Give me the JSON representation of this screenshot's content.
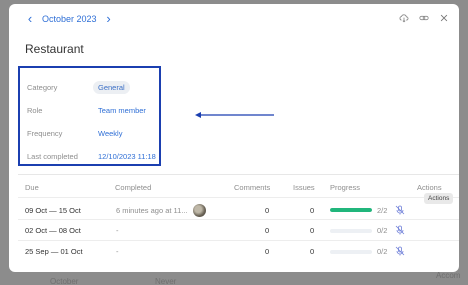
{
  "header": {
    "month_label": "October 2023",
    "prev_icon": "chevron-left-icon",
    "next_icon": "chevron-right-icon",
    "actions": [
      "cloud-download-icon",
      "link-icon",
      "close-icon"
    ]
  },
  "title": "Restaurant",
  "details": {
    "category": {
      "label": "Category",
      "value": "General"
    },
    "role": {
      "label": "Role",
      "value": "Team member"
    },
    "frequency": {
      "label": "Frequency",
      "value": "Weekly"
    },
    "last_completed": {
      "label": "Last completed",
      "value": "12/10/2023 11:18"
    }
  },
  "table": {
    "columns": [
      "Due",
      "Completed",
      "Comments",
      "Issues",
      "Progress",
      "Actions"
    ],
    "rows": [
      {
        "due": "09 Oct — 15 Oct",
        "completed": "6 minutes ago at 11...",
        "comments": "0",
        "issues": "0",
        "progress_text": "2/2",
        "progress_fraction": 1.0
      },
      {
        "due": "02 Oct — 08 Oct",
        "completed": "-",
        "comments": "0",
        "issues": "0",
        "progress_text": "0/2",
        "progress_fraction": 0.0
      },
      {
        "due": "25 Sep — 01 Oct",
        "completed": "-",
        "comments": "0",
        "issues": "0",
        "progress_text": "0/2",
        "progress_fraction": 0.0
      }
    ]
  },
  "tooltip": "Actions",
  "colors": {
    "accent": "#2f6fd6",
    "highlight_box": "#1b3fb0",
    "progress": "#21b67c"
  }
}
